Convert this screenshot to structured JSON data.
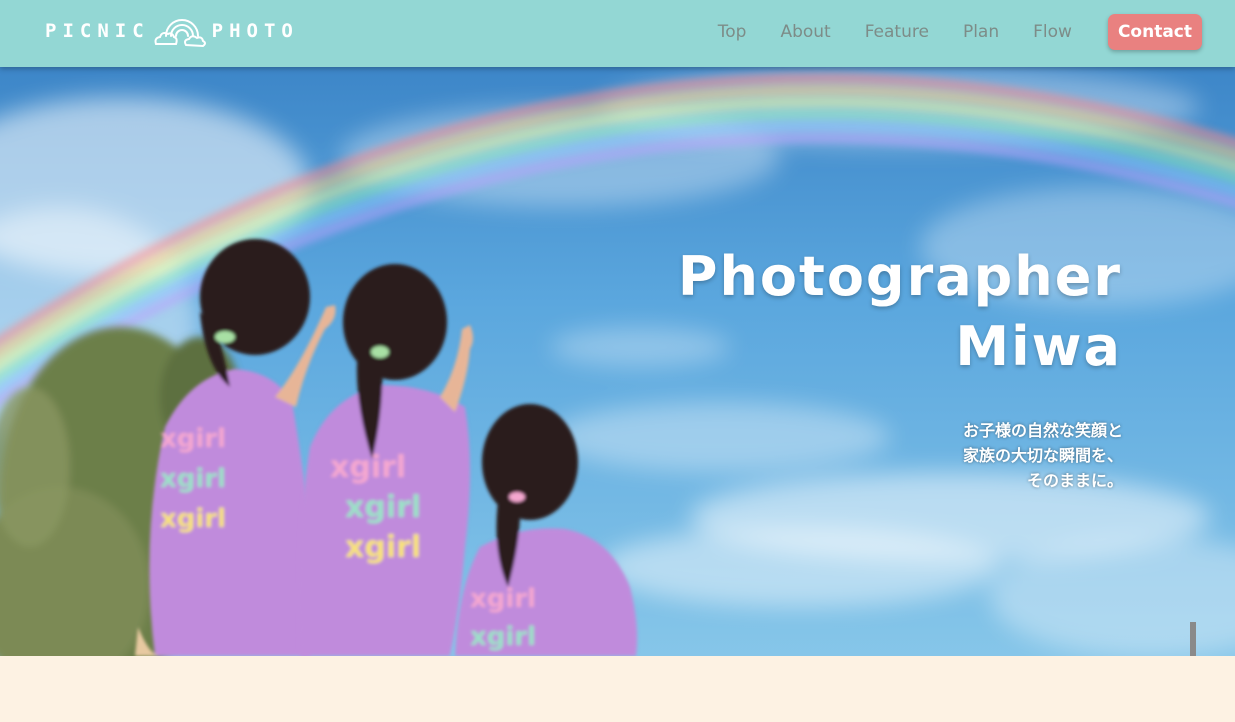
{
  "header": {
    "logo_left": "PICNIC",
    "logo_right": "PHOTO",
    "nav": [
      "Top",
      "About",
      "Feature",
      "Plan",
      "Flow"
    ],
    "contact_label": "Contact"
  },
  "hero": {
    "title_line1": "Photographer",
    "title_line2": "Miwa",
    "subtitle": [
      "お子様の自然な笑顔と",
      "家族の大切な瞬間を、",
      "そのままに。"
    ]
  },
  "colors": {
    "header_bg": "#93d7d4",
    "contact_bg": "#e98180",
    "nav_text": "#7d8c88",
    "page_bg": "#fdf2e3",
    "shirt": "#c48ee0"
  },
  "icons": [
    "rainbow-cloud-icon"
  ]
}
